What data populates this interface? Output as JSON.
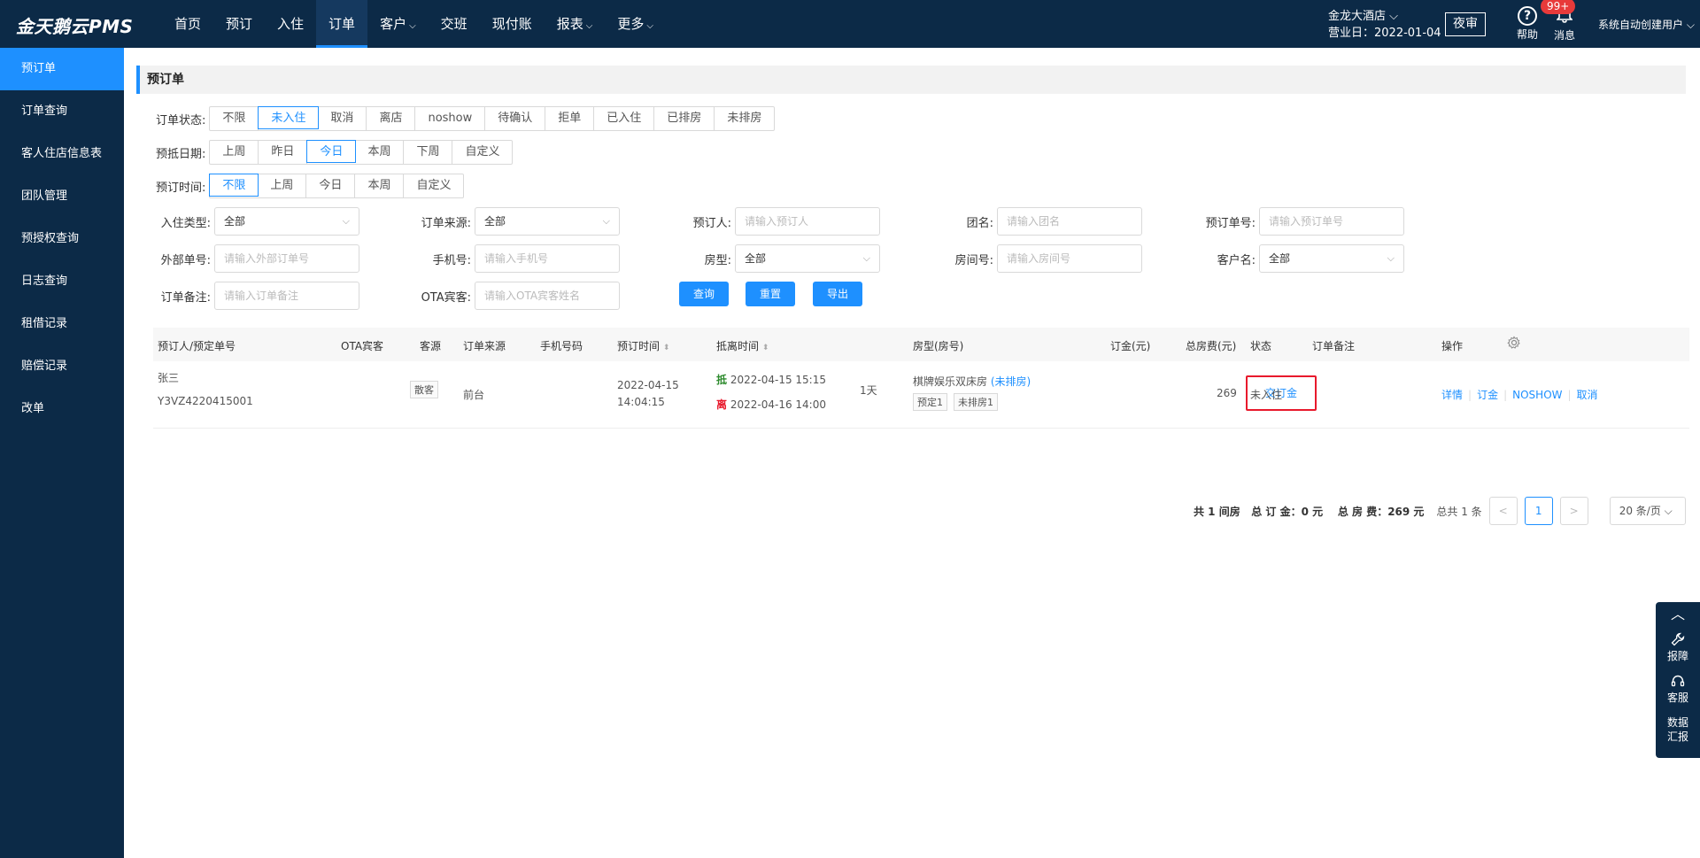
{
  "app": {
    "logo": "金天鹅云PMS"
  },
  "nav": [
    {
      "label": "首页",
      "chev": ""
    },
    {
      "label": "预订",
      "chev": ""
    },
    {
      "label": "入住",
      "chev": ""
    },
    {
      "label": "订单",
      "chev": ""
    },
    {
      "label": "客户",
      "chev": "⌵"
    },
    {
      "label": "交班",
      "chev": ""
    },
    {
      "label": "现付账",
      "chev": ""
    },
    {
      "label": "报表",
      "chev": "⌵"
    },
    {
      "label": "更多",
      "chev": "⌵"
    }
  ],
  "header": {
    "hotel": "金龙大酒店 ⌵",
    "business_day": "营业日：2022-01-04",
    "night_audit": "夜审",
    "help": "帮助",
    "messages": "消息",
    "badge": "99+",
    "user": "系统自动创建用户 ⌵"
  },
  "sidebar": [
    {
      "label": "预订单"
    },
    {
      "label": "订单查询"
    },
    {
      "label": "客人住店信息表"
    },
    {
      "label": "团队管理"
    },
    {
      "label": "预授权查询"
    },
    {
      "label": "日志查询"
    },
    {
      "label": "租借记录"
    },
    {
      "label": "赔偿记录"
    },
    {
      "label": "改单"
    }
  ],
  "page": {
    "title": "预订单",
    "status_label": "订单状态:",
    "status_options": [
      "不限",
      "未入住",
      "取消",
      "离店",
      "noshow",
      "待确认",
      "拒单",
      "已入住",
      "已排房",
      "未排房"
    ],
    "arrival_label": "预抵日期:",
    "arrival_options": [
      "上周",
      "昨日",
      "今日",
      "本周",
      "下周",
      "自定义"
    ],
    "booking_label": "预订时间:",
    "booking_options": [
      "不限",
      "上周",
      "今日",
      "本周",
      "自定义"
    ],
    "fields": {
      "checkin_type": {
        "label": "入住类型:",
        "value": "全部"
      },
      "order_source": {
        "label": "订单来源:",
        "value": "全部"
      },
      "booker": {
        "label": "预订人:",
        "placeholder": "请输入预订人"
      },
      "group": {
        "label": "团名:",
        "placeholder": "请输入团名"
      },
      "order_no": {
        "label": "预订单号:",
        "placeholder": "请输入预订单号"
      },
      "external_no": {
        "label": "外部单号:",
        "placeholder": "请输入外部订单号"
      },
      "phone": {
        "label": "手机号:",
        "placeholder": "请输入手机号"
      },
      "room_type": {
        "label": "房型:",
        "value": "全部"
      },
      "room_no": {
        "label": "房间号:",
        "placeholder": "请输入房间号"
      },
      "customer": {
        "label": "客户名:",
        "value": "全部"
      },
      "remark": {
        "label": "订单备注:",
        "placeholder": "请输入订单备注"
      },
      "ota_guest": {
        "label": "OTA宾客:",
        "placeholder": "请输入OTA宾客姓名"
      }
    },
    "buttons": {
      "query": "查询",
      "reset": "重置",
      "export": "导出"
    }
  },
  "table": {
    "headers": {
      "booker": "预订人/预定单号",
      "ota": "OTA宾客",
      "source": "客源",
      "order_source": "订单来源",
      "phone": "手机号码",
      "booking_time": "预订时间",
      "stay_time": "抵离时间",
      "room": "房型(房号)",
      "deposit": "订金(元)",
      "total": "总房费(元)",
      "status": "状态",
      "remark": "订单备注",
      "action": "操作"
    },
    "sort_glyph": "⬍",
    "row": {
      "name": "张三",
      "order_no": "Y3VZ4220415001",
      "source_tag": "散客",
      "order_source": "前台",
      "booking_date": "2022-04-15",
      "booking_time": "14:04:15",
      "arrive_tag": "抵",
      "arrive": "2022-04-15 15:15",
      "leave_tag": "离",
      "leave": "2022-04-16 14:00",
      "nights": "1天",
      "room_type": "棋牌娱乐双床房",
      "room_status": "(未排房)",
      "tag1": "预定1",
      "tag2": "未排房1",
      "pay_deposit": "交订金",
      "total": "269",
      "status": "未入住",
      "actions": [
        "详情",
        "订金",
        "NOSHOW",
        "取消"
      ]
    }
  },
  "pager": {
    "summary": "共 1 间房   总 订 金：0 元    总 房 费：269 元",
    "total": "总共 1 条",
    "prev": "<",
    "page": "1",
    "next": ">",
    "size": "20 条/页 ⌵"
  },
  "float": {
    "up": "︿",
    "report": "报障",
    "service": "客服",
    "data1": "数据",
    "data2": "汇报"
  }
}
